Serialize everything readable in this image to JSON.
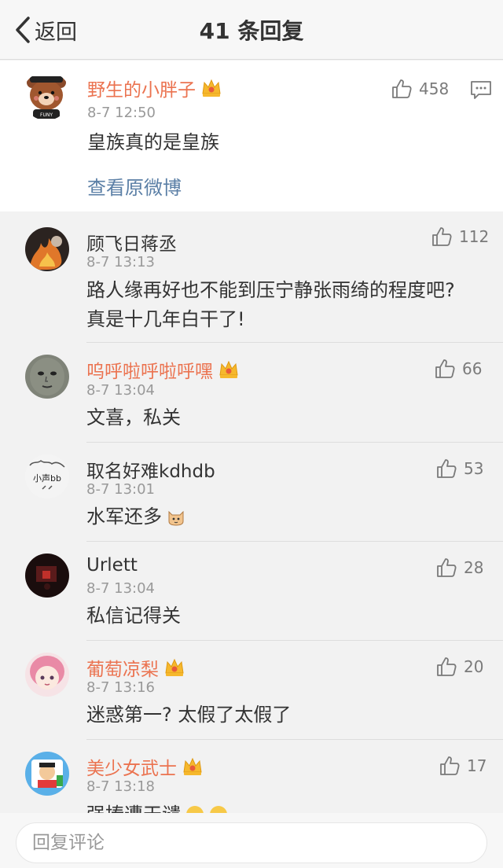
{
  "header": {
    "back_label": "返回",
    "title": "41 条回复"
  },
  "main_comment": {
    "name": "野生的小胖子",
    "time": "8-7 12:50",
    "text": "皇族真的是皇族",
    "likes": "458",
    "link": "查看原微博"
  },
  "replies": [
    {
      "name": "顾飞日蒋丞",
      "time": "8-7 13:13",
      "line1": "路人缘再好也不能到压宁静张雨绮的程度吧?",
      "line2": "真是十几年白干了!",
      "likes": "112"
    },
    {
      "name": "呜呼啦呼啦呼嘿",
      "time": "8-7 13:04",
      "text": "文喜，私关",
      "likes": "66"
    },
    {
      "name": "取名好难kdhdb",
      "time": "8-7 13:01",
      "text": "水军还多",
      "likes": "53"
    },
    {
      "name": "Urlett",
      "time": "8-7 13:04",
      "text": "私信记得关",
      "likes": "28"
    },
    {
      "name": "葡萄凉梨",
      "time": "8-7 13:16",
      "text": "迷惑第一? 太假了太假了",
      "likes": "20"
    },
    {
      "name": "美少女武士",
      "time": "8-7 13:18",
      "text": "强捧遭天谴",
      "likes": "17"
    }
  ],
  "avatar_text": {
    "fun": "FUNY",
    "xiaosheng": "小声bb"
  },
  "input": {
    "placeholder": "回复评论"
  },
  "colors": {
    "vip_name": "#eb7350",
    "link": "#5b7fa6",
    "time": "#999999",
    "background": "#f2f2f2"
  }
}
